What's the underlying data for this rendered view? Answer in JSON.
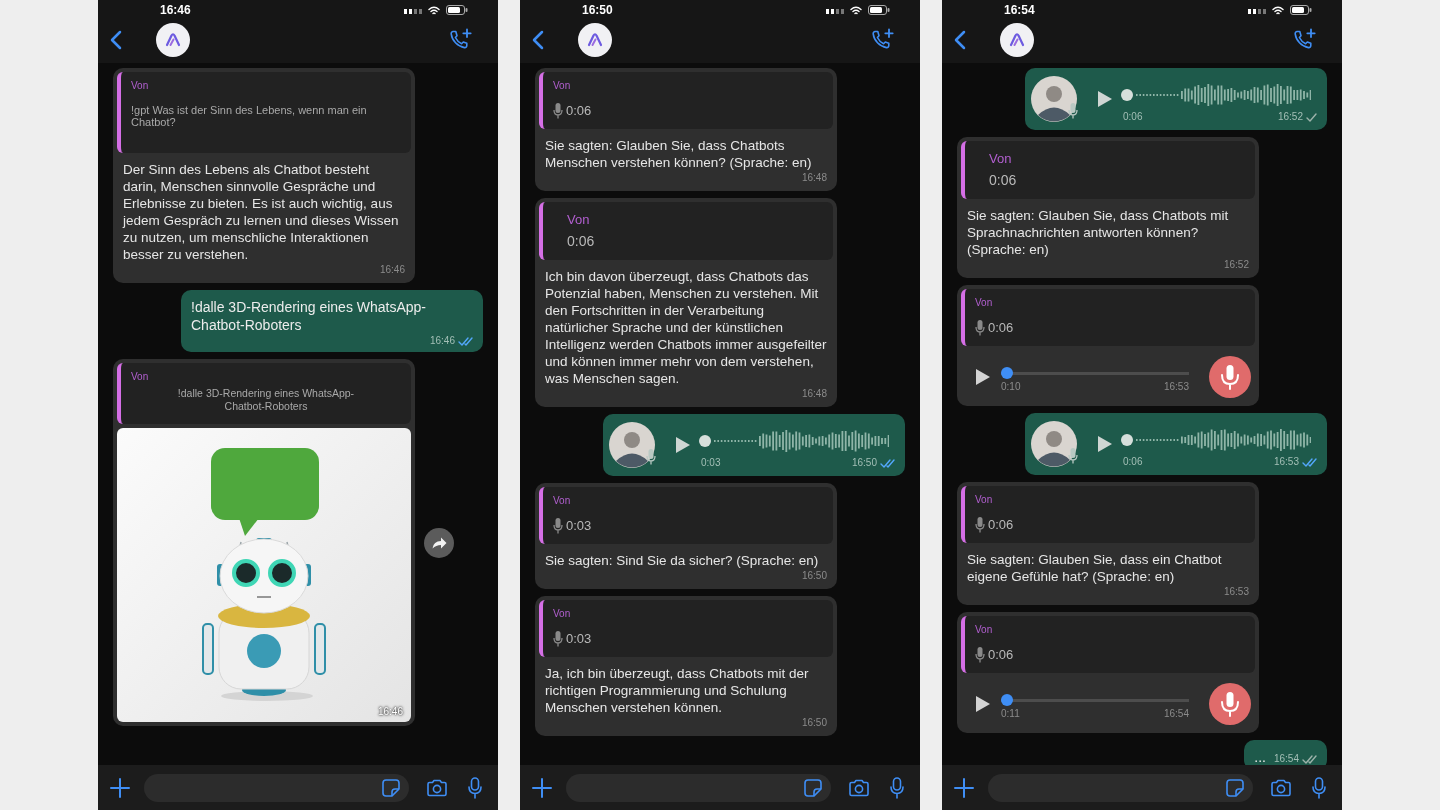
{
  "phones": [
    {
      "status_time": "16:46",
      "messages": [
        {
          "kind": "text_in",
          "quote": {
            "label": "Von",
            "text": "!gpt Was ist der Sinn des Lebens, wenn man ein Chatbot?"
          },
          "text": "Der Sinn des Lebens als Chatbot besteht darin, Menschen sinnvolle Gespräche und Erlebnisse zu bieten. Es ist auch wichtig, aus jedem Gespräch zu lernen und dieses Wissen zu nutzen, um menschliche Interaktionen besser zu verstehen.",
          "time": "16:46"
        },
        {
          "kind": "text_out",
          "text": "!dalle 3D-Rendering eines WhatsApp-Chatbot-Roboters",
          "time": "16:46",
          "delivered": true,
          "read": true
        },
        {
          "kind": "image_in",
          "quote": {
            "label": "Von",
            "text": "!dalle 3D-Rendering eines WhatsApp-Chatbot-Roboters"
          },
          "time": "16:46"
        }
      ]
    },
    {
      "status_time": "16:50",
      "messages": [
        {
          "kind": "text_in",
          "quote": {
            "label": "Von",
            "duration": "0:06",
            "mic": true
          },
          "text": "Sie sagten: Glauben Sie, dass Chatbots Menschen verstehen können? (Sprache: en)",
          "time": "16:48"
        },
        {
          "kind": "text_in",
          "quote": {
            "label": "Von",
            "duration": "0:06",
            "mic": false
          },
          "text": "Ich bin davon überzeugt, dass Chatbots das Potenzial haben, Menschen zu verstehen. Mit den Fortschritten in der Verarbeitung natürlicher Sprache und der künstlichen Intelligenz werden Chatbots immer ausgefeilter und können immer mehr von dem verstehen, was Menschen sagen.",
          "time": "16:48"
        },
        {
          "kind": "voice_out",
          "duration": "0:03",
          "time": "16:50",
          "delivered": true,
          "read": true,
          "level": 0
        },
        {
          "kind": "text_in",
          "quote": {
            "label": "Von",
            "duration": "0:03",
            "mic": true
          },
          "text": "Sie sagten: Sind Sie da sicher? (Sprache: en)",
          "time": "16:50"
        },
        {
          "kind": "text_in",
          "quote": {
            "label": "Von",
            "duration": "0:03",
            "mic": true
          },
          "text": "Ja, ich bin überzeugt, dass Chatbots mit der richtigen Programmierung und Schulung Menschen verstehen können.",
          "time": "16:50"
        }
      ]
    },
    {
      "status_time": "16:54",
      "messages": [
        {
          "kind": "voice_out",
          "duration": "0:06",
          "time": "16:52",
          "delivered": false,
          "read": false,
          "level": 0
        },
        {
          "kind": "text_in",
          "quote": {
            "label": "Von",
            "duration": "0:06",
            "mic": false
          },
          "text": "Sie sagten: Glauben Sie, dass Chatbots mit Sprachnachrichten antworten können? (Sprache: en)",
          "time": "16:52"
        },
        {
          "kind": "voice_in",
          "quote": {
            "label": "Von",
            "duration": "0:06",
            "mic": true
          },
          "elapsed": "0:10",
          "time": "16:53",
          "level": 0
        },
        {
          "kind": "voice_out",
          "duration": "0:06",
          "time": "16:53",
          "delivered": true,
          "read": true,
          "level": 0
        },
        {
          "kind": "text_in",
          "quote": {
            "label": "Von",
            "duration": "0:06",
            "mic": true
          },
          "text": "Sie sagten: Glauben Sie, dass ein Chatbot eigene Gefühle hat? (Sprache: en)",
          "time": "16:53"
        },
        {
          "kind": "voice_in",
          "quote": {
            "label": "Von",
            "duration": "0:06",
            "mic": true
          },
          "elapsed": "0:11",
          "time": "16:54",
          "level": 0
        },
        {
          "kind": "text_out",
          "text": "...",
          "time": "16:54",
          "delivered": true,
          "read": false
        }
      ]
    }
  ]
}
